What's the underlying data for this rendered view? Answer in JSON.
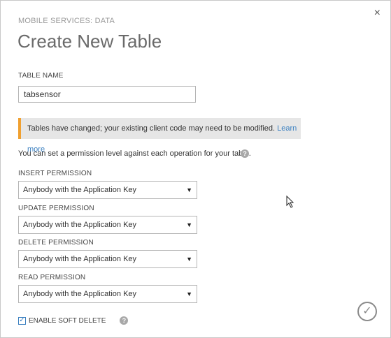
{
  "header": {
    "breadcrumb": "MOBILE SERVICES: DATA",
    "title": "Create New Table",
    "close_icon": "×"
  },
  "table_name": {
    "label": "TABLE NAME",
    "value": "tabsensor"
  },
  "warning": {
    "text": "Tables have changed; your existing client code may need to be modified.",
    "link": "Learn more",
    "accent_color": "#f0a030"
  },
  "info": {
    "text": "You can set a permission level against each operation for your table.",
    "help_icon": "?"
  },
  "permissions": [
    {
      "label": "INSERT PERMISSION",
      "value": "Anybody with the Application Key"
    },
    {
      "label": "UPDATE PERMISSION",
      "value": "Anybody with the Application Key"
    },
    {
      "label": "DELETE PERMISSION",
      "value": "Anybody with the Application Key"
    },
    {
      "label": "READ PERMISSION",
      "value": "Anybody with the Application Key"
    }
  ],
  "soft_delete": {
    "label": "ENABLE SOFT DELETE",
    "checked": true,
    "help_icon": "?"
  },
  "footer": {
    "confirm_icon": "✓"
  }
}
